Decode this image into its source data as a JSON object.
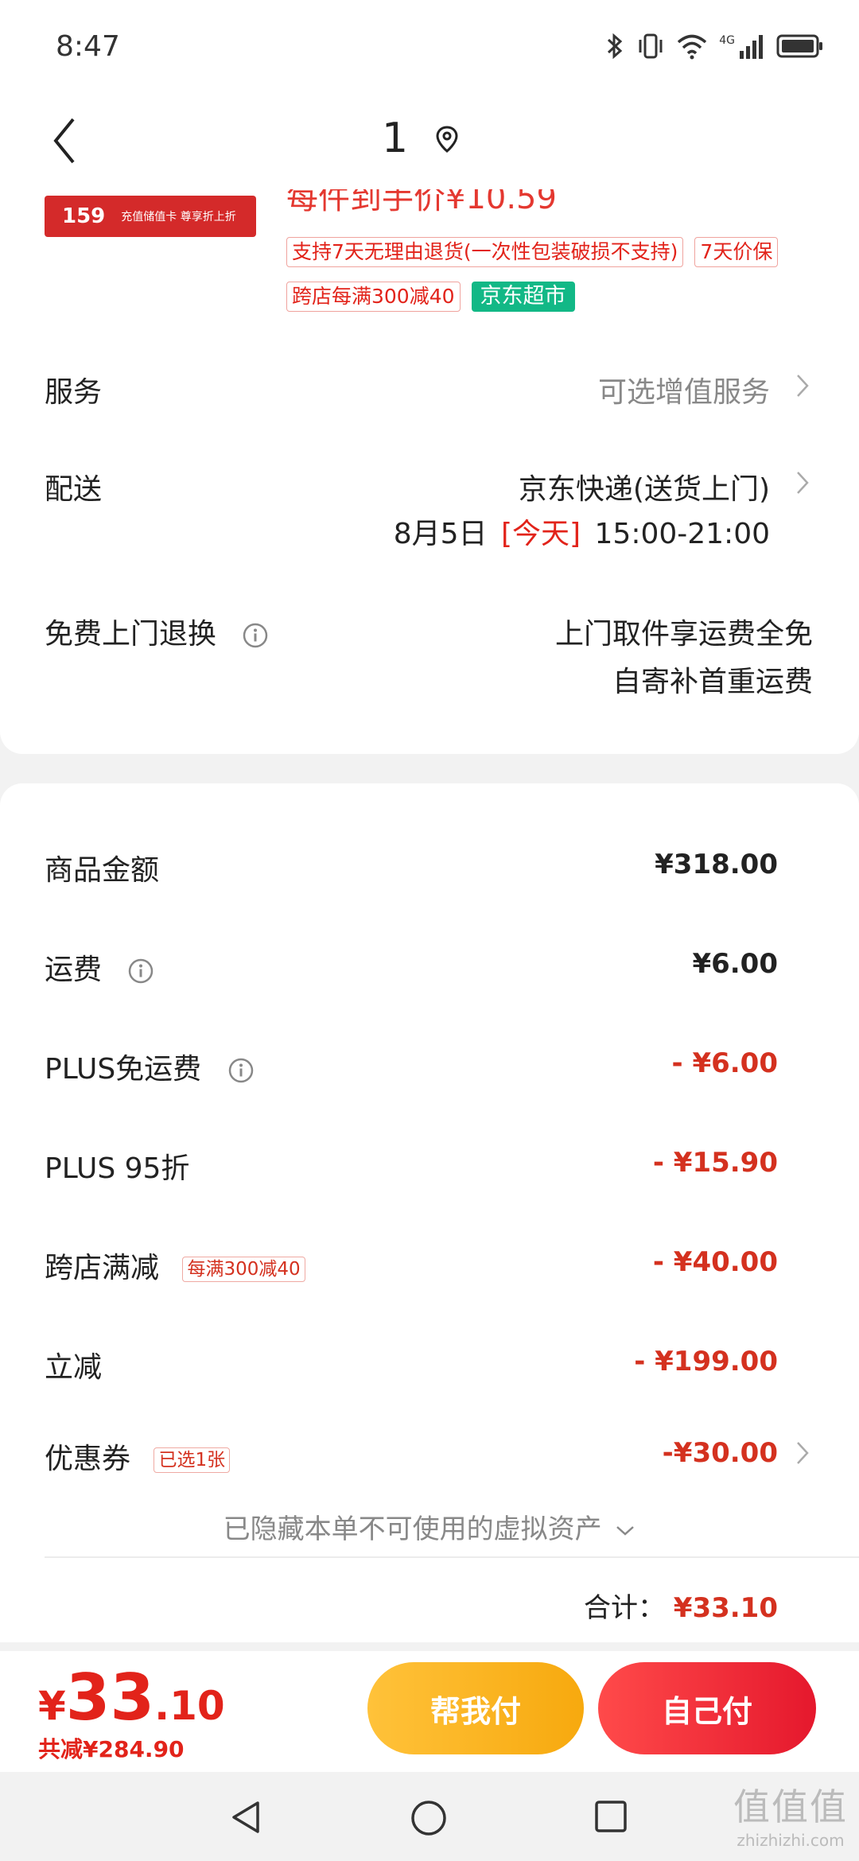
{
  "status": {
    "time": "8:47",
    "network": "4G"
  },
  "nav": {
    "title": "1"
  },
  "product": {
    "thumb_price": "159",
    "thumb_text": "充值储值卡 尊享折上折",
    "per_item_price": "每件到手价¥10.59",
    "tags": [
      "支持7天无理由退货(一次性包装破损不支持)",
      "7天价保",
      "跨店每满300减40",
      "京东超市"
    ]
  },
  "service": {
    "label": "服务",
    "value": "可选增值服务"
  },
  "delivery": {
    "label": "配送",
    "method": "京东快递(送货上门)",
    "date": "8月5日",
    "today": "[今天]",
    "time_slot": "15:00-21:00"
  },
  "return": {
    "label": "免费上门退换",
    "line1": "上门取件享运费全免",
    "line2": "自寄补首重运费"
  },
  "summary": {
    "goods_label": "商品金额",
    "goods_value": "¥318.00",
    "shipping_label": "运费",
    "shipping_value": "¥6.00",
    "plus_free_label": "PLUS免运费",
    "plus_free_value": "- ¥6.00",
    "plus95_label": "PLUS 95折",
    "plus95_value": "- ¥15.90",
    "cross_label": "跨店满减",
    "cross_tag": "每满300减40",
    "cross_value": "- ¥40.00",
    "instant_label": "立减",
    "instant_value": "- ¥199.00",
    "coupon_label": "优惠券",
    "coupon_tag": "已选1张",
    "coupon_value": "-¥30.00",
    "hidden_assets": "已隐藏本单不可使用的虚拟资产",
    "total_label": "合计：",
    "total_value": "¥33.10"
  },
  "bottom": {
    "yen": "¥",
    "int": "33",
    "dec": ".10",
    "saved": "共减¥284.90",
    "help_pay": "帮我付",
    "self_pay": "自己付"
  },
  "watermark": {
    "line1": "值值值",
    "line2": "zhizhizhi.com"
  }
}
